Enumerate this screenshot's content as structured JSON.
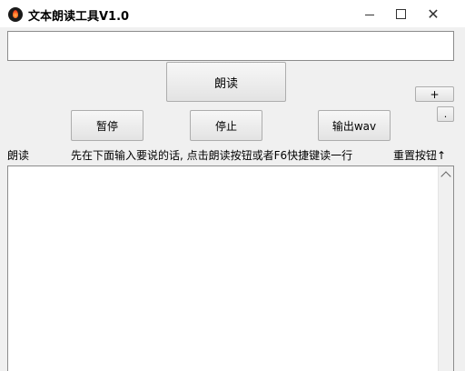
{
  "window": {
    "title": "文本朗读工具V1.0",
    "close_glyph": "✕",
    "icon": "flame-app-icon"
  },
  "input": {
    "value": ""
  },
  "buttons": {
    "read": "朗读",
    "plus": "+",
    "dot": ".",
    "pause": "暂停",
    "stop": "停止",
    "export_wav": "输出wav"
  },
  "labels": {
    "read": "朗读",
    "hint": "先在下面输入要说的话, 点击朗读按钮或者F6快捷键读一行",
    "reset": "重置按钮↑"
  },
  "colors": {
    "window_bg": "#f0f0f0",
    "field_bg": "#ffffff",
    "border": "#8c8c8c"
  }
}
